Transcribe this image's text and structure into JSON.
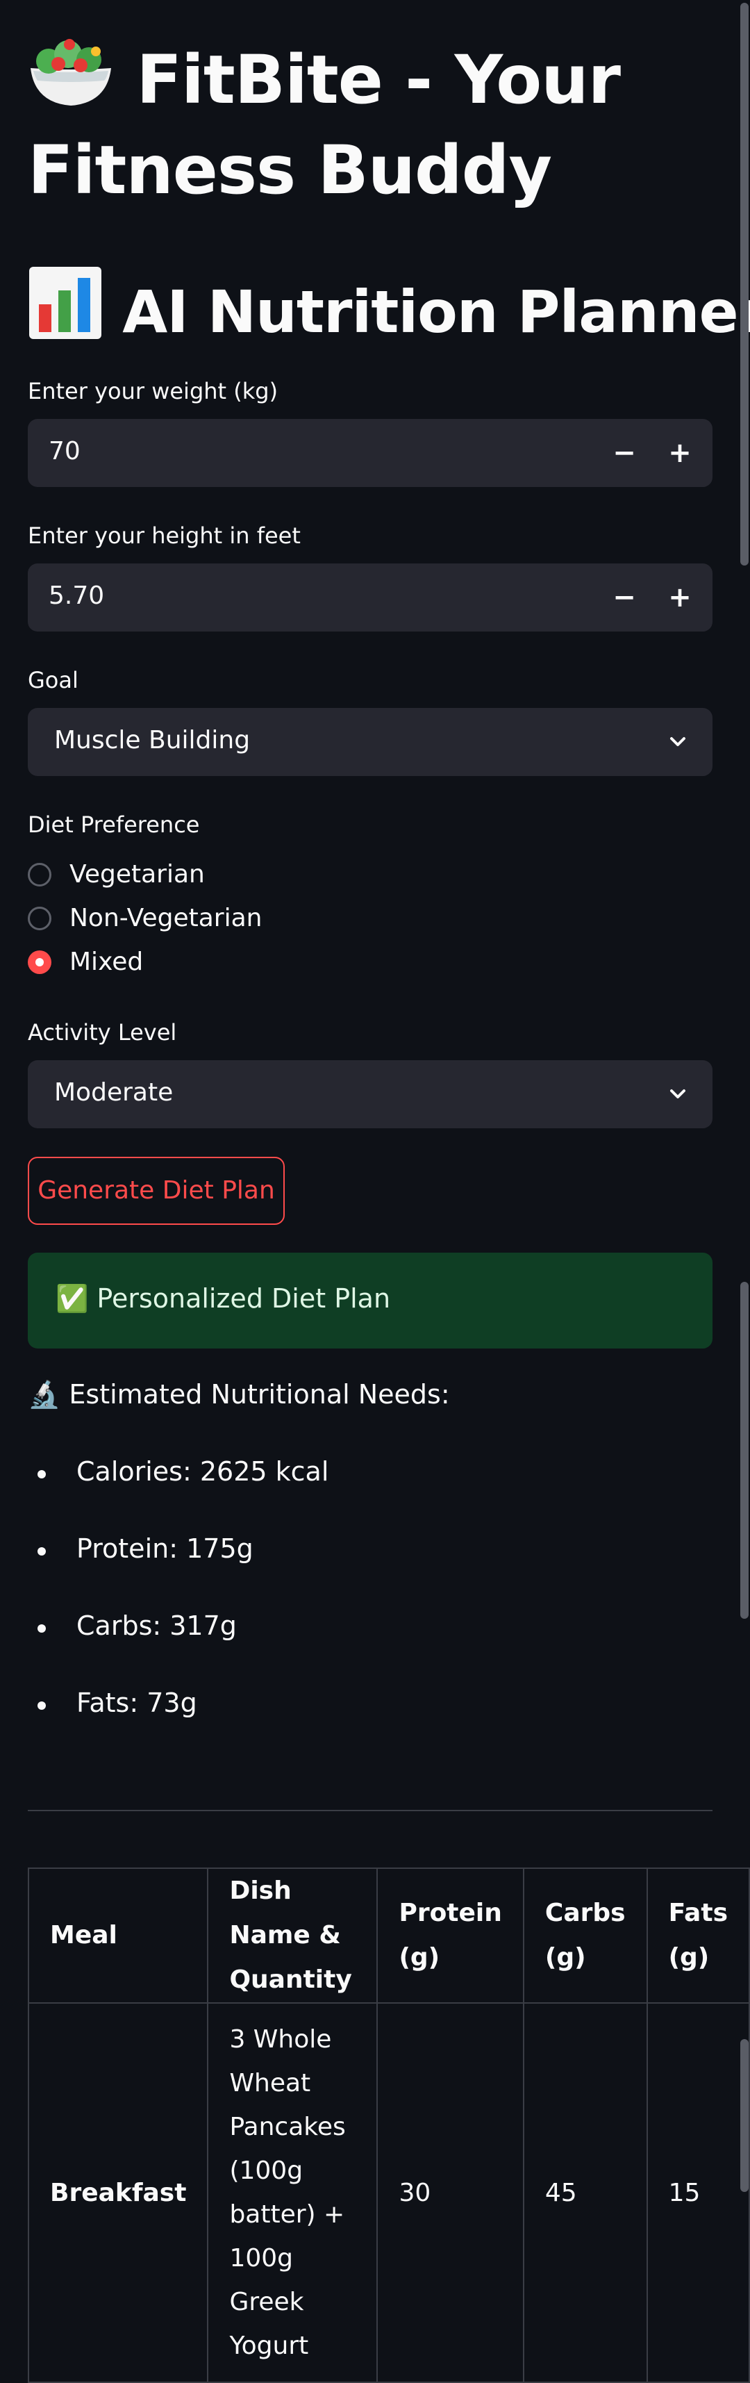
{
  "page": {
    "title": "FitBite - Your Fitness Buddy",
    "title_icon": "salad-emoji",
    "subtitle": "AI Nutrition Planner",
    "subtitle_icon": "bar-chart-emoji"
  },
  "form": {
    "weight": {
      "label": "Enter your weight (kg)",
      "value": "70",
      "minus": "−",
      "plus": "+"
    },
    "height": {
      "label": "Enter your height in feet",
      "value": "5.70",
      "minus": "−",
      "plus": "+"
    },
    "goal": {
      "label": "Goal",
      "value": "Muscle Building"
    },
    "diet": {
      "label": "Diet Preference",
      "options": [
        "Vegetarian",
        "Non-Vegetarian",
        "Mixed"
      ],
      "selected": "Mixed"
    },
    "activity": {
      "label": "Activity Level",
      "value": "Moderate"
    },
    "generate_button": "Generate Diet Plan"
  },
  "result": {
    "success_text": "✅ Personalized Diet Plan",
    "needs_title": "🔬 Estimated Nutritional Needs:",
    "needs": [
      "Calories: 2625 kcal",
      "Protein: 175g",
      "Carbs: 317g",
      "Fats: 73g"
    ]
  },
  "table": {
    "headers": [
      "Meal",
      "Dish Name & Quantity",
      "Protein (g)",
      "Carbs (g)",
      "Fats (g)"
    ],
    "rows": [
      [
        "Breakfast",
        "3 Whole Wheat Pancakes (100g batter) + 100g Greek Yogurt",
        "30",
        "45",
        "15"
      ]
    ]
  },
  "colors": {
    "background": "#0e1117",
    "input_bg": "#262730",
    "accent": "#ff4b4b",
    "success_bg": "#0f3e24"
  }
}
